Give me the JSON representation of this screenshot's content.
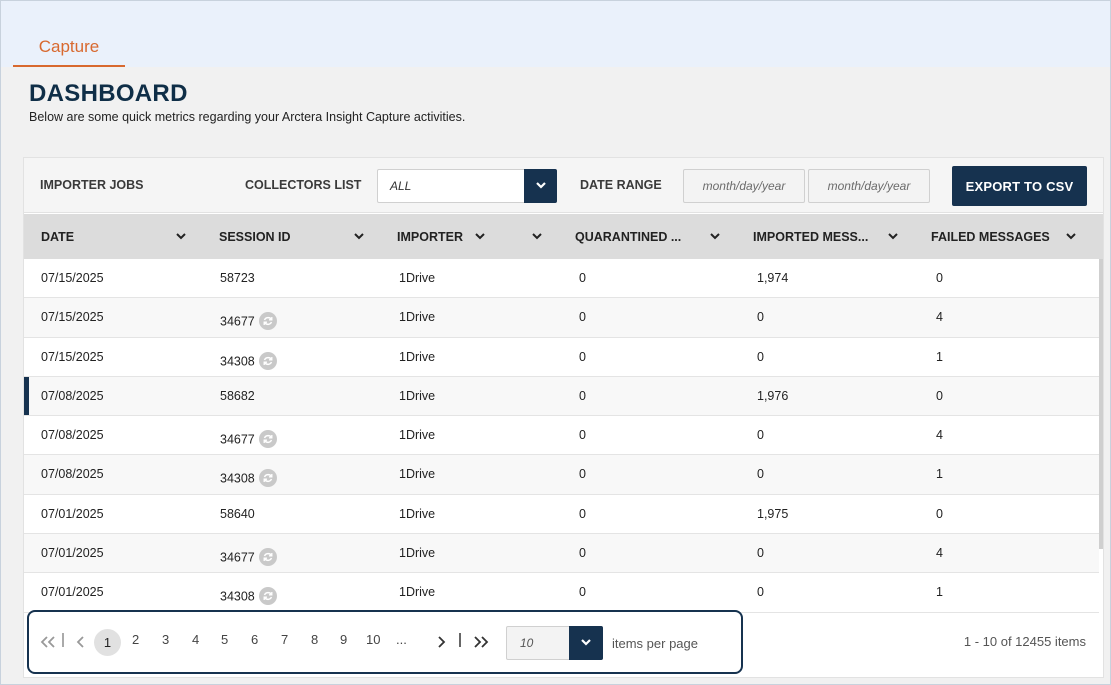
{
  "tabs": [
    {
      "label": "Capture",
      "active": true
    }
  ],
  "page": {
    "title": "DASHBOARD",
    "subtitle": "Below are some quick metrics regarding your Arctera Insight Capture activities."
  },
  "filters": {
    "section_label": "IMPORTER JOBS",
    "collectors_label": "COLLECTORS LIST",
    "collectors_value": "ALL",
    "date_range_label": "DATE RANGE",
    "date_from_placeholder": "month/day/year",
    "date_to_placeholder": "month/day/year",
    "export_label": "EXPORT TO CSV"
  },
  "table": {
    "columns": [
      "DATE",
      "SESSION ID",
      "IMPORTER",
      "QUARANTINED ...",
      "IMPORTED MESS...",
      "FAILED MESSAGES"
    ],
    "rows": [
      {
        "date": "07/15/2025",
        "session": "58723",
        "importer": "1Drive",
        "quarantined": "0",
        "imported": "1,974",
        "failed": "0",
        "sync": false
      },
      {
        "date": "07/15/2025",
        "session": "34677",
        "importer": "1Drive",
        "quarantined": "0",
        "imported": "0",
        "failed": "4",
        "sync": true
      },
      {
        "date": "07/15/2025",
        "session": "34308",
        "importer": "1Drive",
        "quarantined": "0",
        "imported": "0",
        "failed": "1",
        "sync": true
      },
      {
        "date": "07/08/2025",
        "session": "58682",
        "importer": "1Drive",
        "quarantined": "0",
        "imported": "1,976",
        "failed": "0",
        "sync": false
      },
      {
        "date": "07/08/2025",
        "session": "34677",
        "importer": "1Drive",
        "quarantined": "0",
        "imported": "0",
        "failed": "4",
        "sync": true
      },
      {
        "date": "07/08/2025",
        "session": "34308",
        "importer": "1Drive",
        "quarantined": "0",
        "imported": "0",
        "failed": "1",
        "sync": true
      },
      {
        "date": "07/01/2025",
        "session": "58640",
        "importer": "1Drive",
        "quarantined": "0",
        "imported": "1,975",
        "failed": "0",
        "sync": false
      },
      {
        "date": "07/01/2025",
        "session": "34677",
        "importer": "1Drive",
        "quarantined": "0",
        "imported": "0",
        "failed": "4",
        "sync": true
      },
      {
        "date": "07/01/2025",
        "session": "34308",
        "importer": "1Drive",
        "quarantined": "0",
        "imported": "0",
        "failed": "1",
        "sync": true
      }
    ],
    "selected_row": 3
  },
  "pagination": {
    "first_icon": "double-chevron-left-icon",
    "prev_icon": "chevron-left-icon",
    "pages": [
      "1",
      "2",
      "3",
      "4",
      "5",
      "6",
      "7",
      "8",
      "9",
      "10",
      "..."
    ],
    "current_page": "1",
    "next_icon": "chevron-right-icon",
    "last_icon": "double-chevron-right-icon",
    "items_per_page": "10",
    "items_per_page_label": "items per page",
    "summary": "1 - 10 of 12455 items"
  },
  "colors": {
    "accent": "#d8692f",
    "primary": "#16324f",
    "title": "#0f2e47"
  }
}
